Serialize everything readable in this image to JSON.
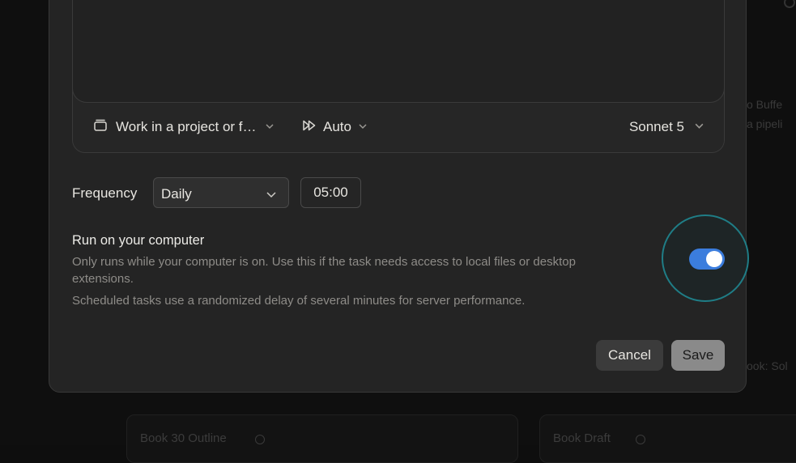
{
  "background": {
    "side_text": [
      "o Buffe",
      "a pipeli",
      "ook: Sol"
    ],
    "cards": [
      "Book 30 Outline",
      "Book Draft"
    ]
  },
  "composer": {
    "project_label": "Work in a project or f…",
    "mode_label": "Auto",
    "model_label": "Sonnet 5"
  },
  "schedule": {
    "frequency_label": "Frequency",
    "frequency_value": "Daily",
    "time_value": "05:00"
  },
  "run_local": {
    "title": "Run on your computer",
    "description": "Only runs while your computer is on. Use this if the task needs access to local files or desktop extensions.",
    "note": "Scheduled tasks use a randomized delay of several minutes for server performance.",
    "enabled": true
  },
  "actions": {
    "cancel_label": "Cancel",
    "save_label": "Save"
  },
  "colors": {
    "toggle_on": "#3b7ddd",
    "focus_ring": "#1f7d86",
    "dialog_bg": "#242424"
  },
  "icons": [
    "folder-icon",
    "chevron-down-icon",
    "fast-forward-icon",
    "gear-icon"
  ]
}
